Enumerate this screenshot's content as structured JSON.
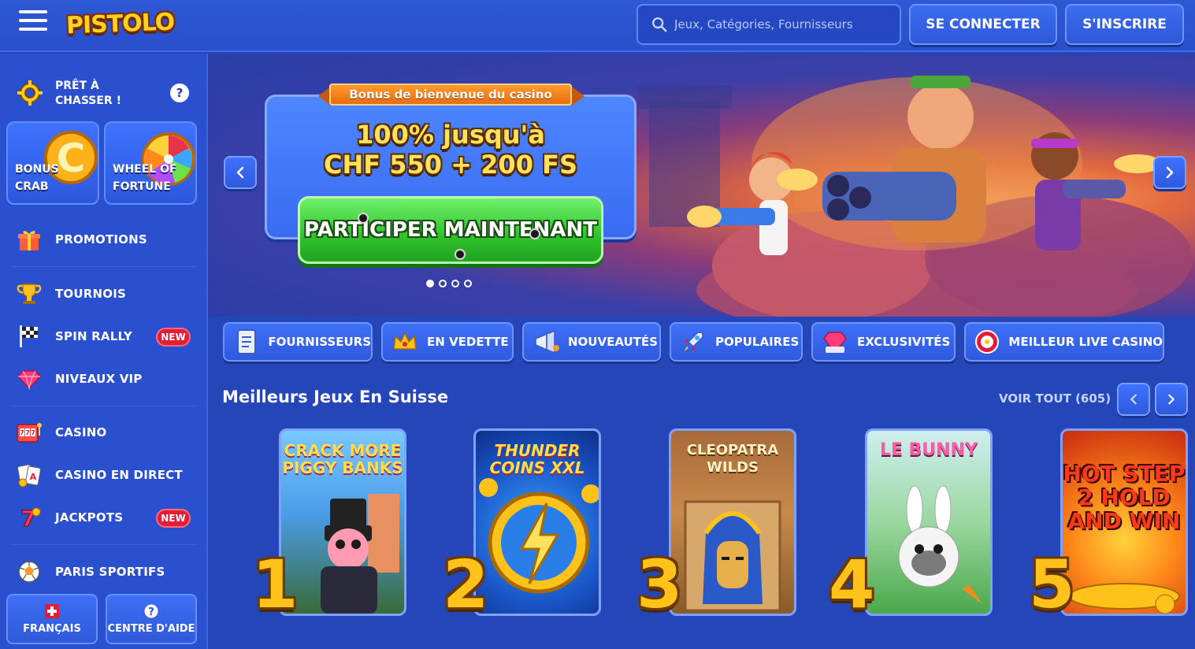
{
  "header": {
    "logo_text": "PISTOLO",
    "search_placeholder": "Jeux, Catégories, Fournisseurs",
    "login_label": "SE CONNECTER",
    "signup_label": "S'INSCRIRE"
  },
  "sidebar": {
    "hunt_label": "PRÊT À CHASSER !",
    "tiles": [
      {
        "label": "BONUS CRAB"
      },
      {
        "label": "WHEEL OF FORTUNE"
      }
    ],
    "items": [
      {
        "label": "PROMOTIONS",
        "icon": "gift-icon"
      },
      {
        "label": "TOURNOIS",
        "icon": "trophy-icon"
      },
      {
        "label": "SPIN RALLY",
        "icon": "racing-flag-icon",
        "badge": "NEW"
      },
      {
        "label": "NIVEAUX VIP",
        "icon": "gem-icon"
      },
      {
        "label": "CASINO",
        "icon": "slot-machine-icon"
      },
      {
        "label": "CASINO EN DIRECT",
        "icon": "cards-icon"
      },
      {
        "label": "JACKPOTS",
        "icon": "lucky-seven-icon",
        "badge": "NEW"
      },
      {
        "label": "PARIS SPORTIFS",
        "icon": "football-icon"
      }
    ],
    "footer": {
      "language_label": "FRANÇAIS",
      "help_label": "CENTRE D'AIDE"
    }
  },
  "hero": {
    "ribbon": "Bonus de bienvenue du casino",
    "line1": "100% jusqu'à",
    "line2": "CHF 550 + 200 FS",
    "cta": "PARTICIPER MAINTENANT",
    "slides_total": 4,
    "active_slide": 1
  },
  "categories": [
    {
      "label": "FOURNISSEURS",
      "icon": "notepad-icon"
    },
    {
      "label": "EN VEDETTE",
      "icon": "crown-icon"
    },
    {
      "label": "NOUVEAUTÉS",
      "icon": "megaphone-icon"
    },
    {
      "label": "POPULAIRES",
      "icon": "rocket-icon"
    },
    {
      "label": "EXCLUSIVITÉS",
      "icon": "diamond-icon"
    },
    {
      "label": "MEILLEUR LIVE CASINO",
      "icon": "roulette-icon"
    }
  ],
  "games_section": {
    "title": "Meilleurs Jeux En Suisse",
    "see_all": "VOIR TOUT (605)",
    "games": [
      {
        "rank": "1",
        "title": "CRACK MORE PIGGY BANKS"
      },
      {
        "rank": "2",
        "title": "THUNDER COINS XXL"
      },
      {
        "rank": "3",
        "title": "CLEOPATRA WILDS"
      },
      {
        "rank": "4",
        "title": "LE BUNNY"
      },
      {
        "rank": "5",
        "title": "HOT STEP 2 HOLD AND WIN"
      }
    ]
  },
  "colors": {
    "bg": "#2546b8",
    "accent_green": "#2fc32c",
    "badge_red": "#e21d35",
    "promo_yellow": "#ffe15a"
  }
}
